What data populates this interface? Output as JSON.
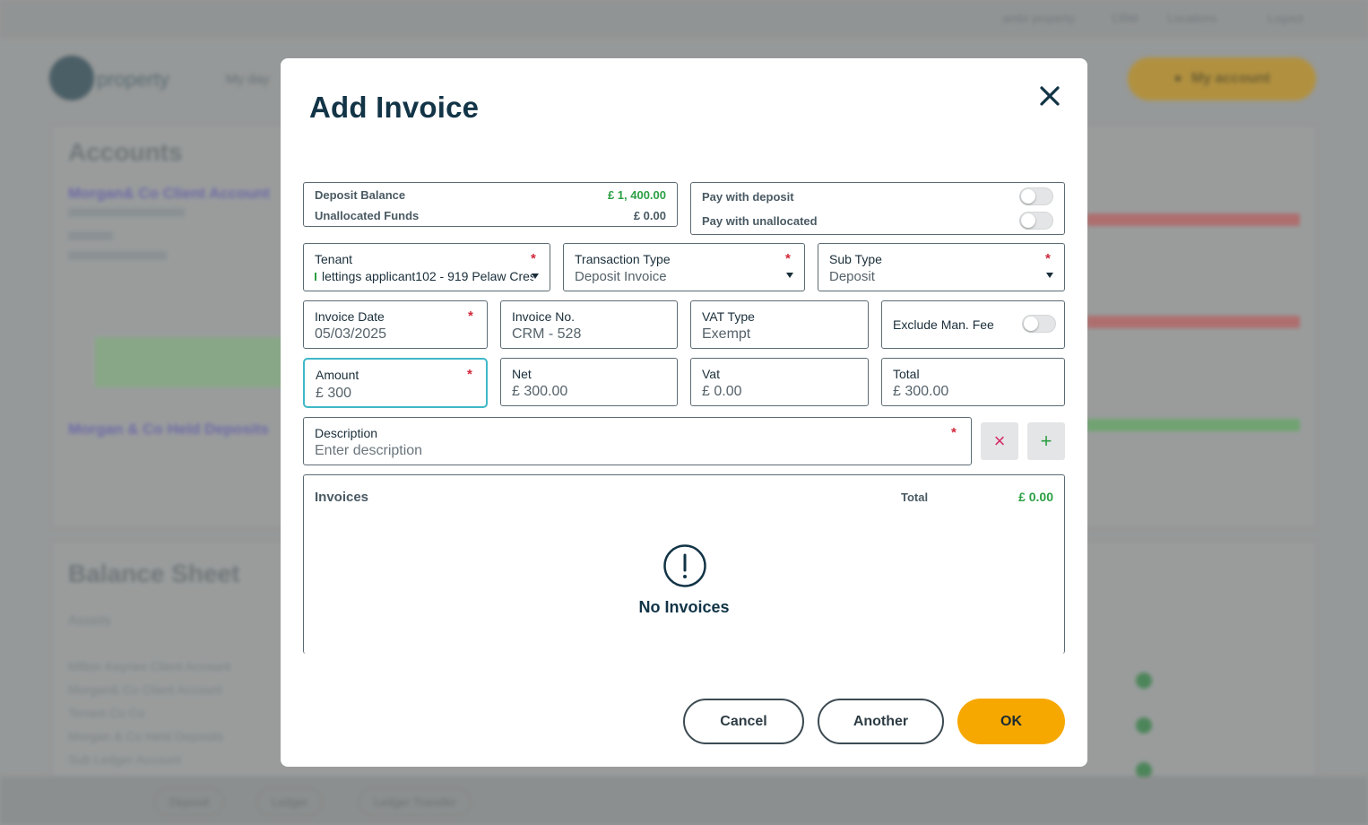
{
  "background": {
    "top_links": [
      "ambr property",
      "CRM",
      "Locations",
      "Logout"
    ],
    "logo_text": "property",
    "nav_text": "My day",
    "account_button": "My account",
    "accounts_heading": "Accounts",
    "account_rows": [
      "Morgan& Co Client Account",
      "Morgan & Co Held Deposits"
    ],
    "balance_sheet_heading": "Balance Sheet",
    "assets_label": "Assets",
    "asset_rows": [
      "Milton Keynes Client Account",
      "Morgan& Co Client Account",
      "Tenant Co Co",
      "Morgan & Co Held Deposits",
      "Sub Ledger Account"
    ],
    "bottom_pills": [
      "Deposit",
      "Ledger",
      "Ledger Transfer"
    ]
  },
  "modal": {
    "title": "Add Invoice",
    "balance": {
      "deposit_balance_label": "Deposit Balance",
      "deposit_balance_value": "£ 1, 400.00",
      "unallocated_funds_label": "Unallocated Funds",
      "unallocated_funds_value": "£ 0.00"
    },
    "pay_options": {
      "pay_with_deposit_label": "Pay with deposit",
      "pay_with_deposit_on": false,
      "pay_with_unallocated_label": "Pay with unallocated",
      "pay_with_unallocated_on": false
    },
    "tenant": {
      "label": "Tenant",
      "value": "lettings applicant102 - 919 Pelaw Cres"
    },
    "transaction_type": {
      "label": "Transaction Type",
      "value": "Deposit Invoice"
    },
    "sub_type": {
      "label": "Sub Type",
      "value": "Deposit"
    },
    "invoice_date": {
      "label": "Invoice Date",
      "value": "05/03/2025"
    },
    "invoice_no": {
      "label": "Invoice No.",
      "value": "CRM - 528"
    },
    "vat_type": {
      "label": "VAT Type",
      "value": "Exempt"
    },
    "exclude_man_fee": {
      "label": "Exclude Man. Fee",
      "on": false
    },
    "amount": {
      "label": "Amount",
      "value": "£ 300"
    },
    "net": {
      "label": "Net",
      "value": "£ 300.00"
    },
    "vat": {
      "label": "Vat",
      "value": "£ 0.00"
    },
    "total": {
      "label": "Total",
      "value": "£ 300.00"
    },
    "description": {
      "label": "Description",
      "placeholder": "Enter description"
    },
    "required_mark": "*",
    "clear_symbol": "×",
    "add_symbol": "+",
    "invoices": {
      "title": "Invoices",
      "total_label": "Total",
      "total_value": "£ 0.00",
      "empty_text": "No Invoices"
    },
    "buttons": {
      "cancel": "Cancel",
      "another": "Another",
      "ok": "OK"
    }
  },
  "colors": {
    "accent_ok": "#f6a800",
    "positive_amount": "#2ca044",
    "required": "#d0283a",
    "active_border": "#3fb8c8",
    "clear_icon": "#d62a6a",
    "add_icon": "#2ca044"
  }
}
